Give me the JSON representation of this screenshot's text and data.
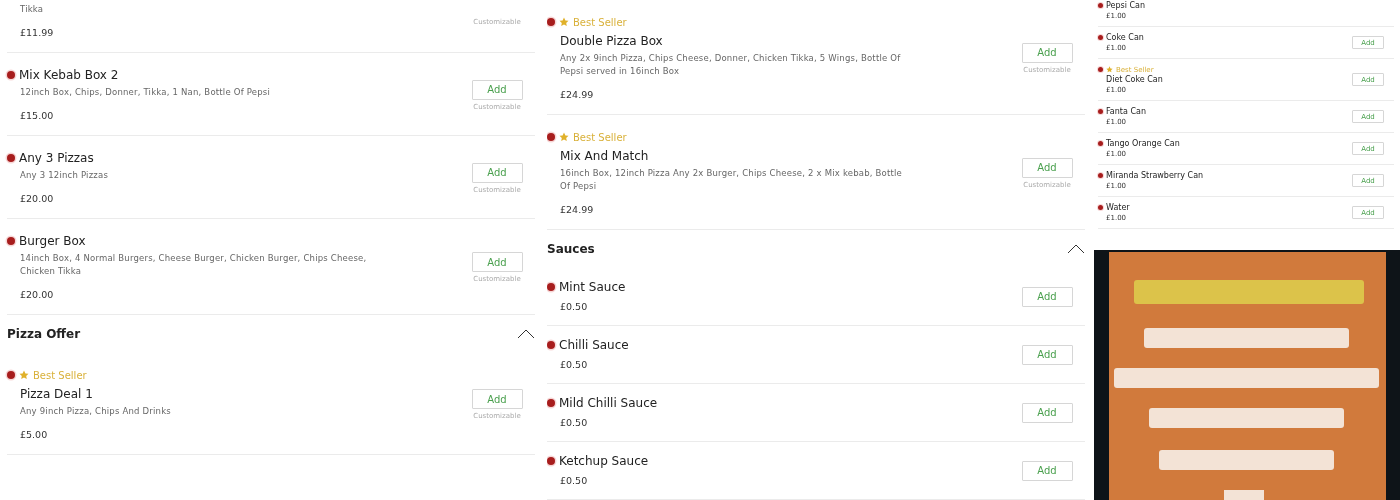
{
  "columns": [
    {
      "entries": [
        {
          "kind": "item",
          "description": "Tikka",
          "price": "£11.99",
          "note": "Customizable"
        },
        {
          "kind": "item",
          "name": "Mix Kebab Box 2",
          "description": "12inch Box, Chips, Donner, Tikka, 1 Nan, Bottle Of Pepsi",
          "price": "£15.00",
          "note": "Customizable",
          "button": "Add"
        },
        {
          "kind": "item",
          "name": "Any 3 Pizzas",
          "description": "Any 3 12inch Pizzas",
          "price": "£20.00",
          "note": "Customizable",
          "button": "Add"
        },
        {
          "kind": "item",
          "name": "Burger Box",
          "description": "14inch Box, 4 Normal Burgers, Cheese Burger, Chicken Burger, Chips Cheese, Chicken Tikka",
          "price": "£20.00",
          "note": "Customizable",
          "button": "Add"
        },
        {
          "kind": "section",
          "title": "Pizza Offer",
          "expanded": true
        },
        {
          "kind": "item",
          "name": "Pizza Deal 1",
          "badge": "Best Seller",
          "description": "Any 9inch Pizza, Chips And Drinks",
          "price": "£5.00",
          "note": "Customizable",
          "button": "Add"
        }
      ]
    },
    {
      "entries": [
        {
          "kind": "item",
          "name": "Double Pizza Box",
          "badge": "Best Seller",
          "description": "Any 2x 9inch Pizza, Chips Cheese, Donner, Chicken Tikka, 5 Wings, Bottle Of Pepsi served in 16inch Box",
          "price": "£24.99",
          "note": "Customizable",
          "button": "Add"
        },
        {
          "kind": "item",
          "name": "Mix And Match",
          "badge": "Best Seller",
          "description": "16inch Box, 12inch Pizza Any 2x Burger, Chips Cheese, 2 x Mix kebab, Bottle Of Pepsi",
          "price": "£24.99",
          "note": "Customizable",
          "button": "Add"
        },
        {
          "kind": "section",
          "title": "Sauces",
          "expanded": true
        },
        {
          "kind": "item",
          "name": "Mint Sauce",
          "price": "£0.50",
          "button": "Add"
        },
        {
          "kind": "item",
          "name": "Chilli Sauce",
          "price": "£0.50",
          "button": "Add"
        },
        {
          "kind": "item",
          "name": "Mild Chilli Sauce",
          "price": "£0.50",
          "button": "Add"
        },
        {
          "kind": "item",
          "name": "Ketchup Sauce",
          "price": "£0.50",
          "button": "Add"
        }
      ]
    },
    {
      "entries": [
        {
          "kind": "item",
          "name": "Pepsi Can",
          "price": "£1.00"
        },
        {
          "kind": "item",
          "name": "Coke Can",
          "price": "£1.00",
          "button": "Add"
        },
        {
          "kind": "item",
          "name": "Diet Coke Can",
          "badge": "Best Seller",
          "price": "£1.00",
          "button": "Add"
        },
        {
          "kind": "item",
          "name": "Fanta Can",
          "price": "£1.00",
          "button": "Add"
        },
        {
          "kind": "item",
          "name": "Tango Orange Can",
          "price": "£1.00",
          "button": "Add"
        },
        {
          "kind": "item",
          "name": "Miranda Strawberry Can",
          "price": "£1.00",
          "button": "Add"
        },
        {
          "kind": "item",
          "name": "Water",
          "price": "£1.00",
          "button": "Add"
        }
      ]
    }
  ]
}
